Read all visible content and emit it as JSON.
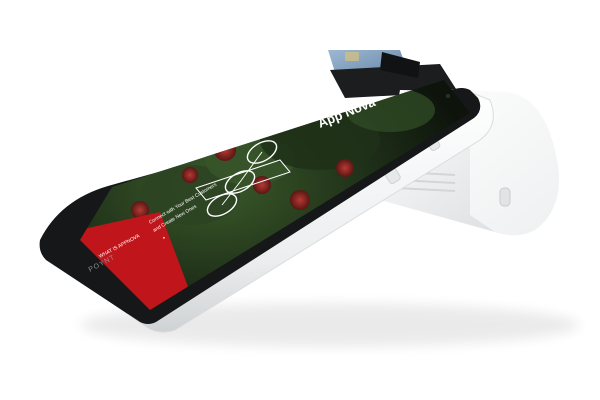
{
  "device": {
    "brand_label": "POYNT",
    "screen_logo": "App Nova",
    "screen_tagline_line1": "Connect with Your Best Customers",
    "screen_tagline_line2": "and Create New Ones",
    "screen_button_label": "WHAT IS APPNOVA",
    "pager_dot": "•"
  },
  "colors": {
    "screen_red": "#c0151b",
    "device_white": "#f4f5f6",
    "bezel_black": "#151719",
    "card_blue": "#7f9fc0"
  }
}
